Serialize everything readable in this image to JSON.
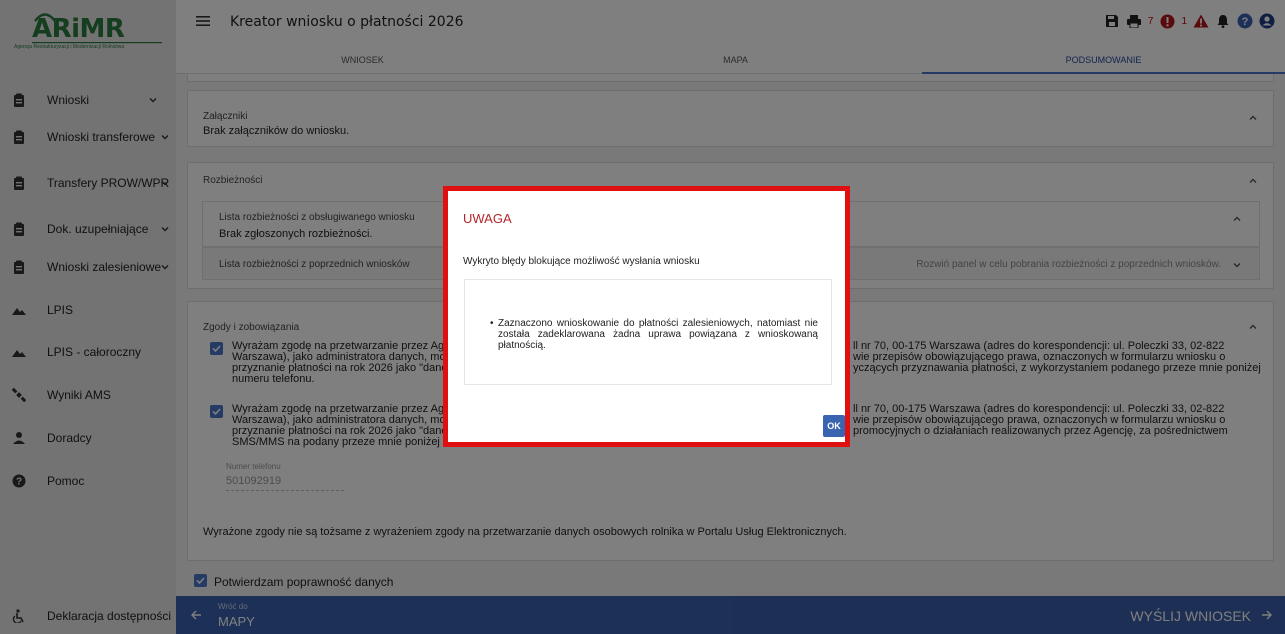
{
  "app": {
    "logo_text": "ARiMR",
    "logo_subtitle": "Agencja Restrukturyzacji i Modernizacji Rolnictwa",
    "title": "Kreator wniosku o płatności 2026"
  },
  "header_icons": {
    "error_count": "7",
    "warning_count": "1"
  },
  "tabs": [
    {
      "label": "WNIOSEK"
    },
    {
      "label": "MAPA"
    },
    {
      "label": "PODSUMOWANIE"
    }
  ],
  "sidebar": {
    "items": [
      {
        "label": "Wnioski",
        "icon": "clipboard-icon"
      },
      {
        "label": "Wnioski transferowe",
        "icon": "clipboard-icon"
      },
      {
        "label": "Transfery PROW/WPR",
        "icon": "clipboard-icon"
      },
      {
        "label": "Dok. uzupełniające",
        "icon": "clipboard-icon"
      },
      {
        "label": "Wnioski zalesieniowe",
        "icon": "clipboard-icon"
      },
      {
        "label": "LPIS",
        "icon": "map-terrain-icon"
      },
      {
        "label": "LPIS - całoroczny",
        "icon": "map-terrain-icon"
      },
      {
        "label": "Wyniki AMS",
        "icon": "satellite-icon"
      },
      {
        "label": "Doradcy",
        "icon": "person-icon"
      },
      {
        "label": "Pomoc",
        "icon": "help-icon"
      }
    ],
    "accessibility": "Deklaracja dostępności"
  },
  "attachments": {
    "title": "Załączniki",
    "text": "Brak załączników do wniosku."
  },
  "discrepancies": {
    "title": "Rozbieżności",
    "current_title": "Lista rozbieżności z obsługiwanego wniosku",
    "current_text": "Brak zgłoszonych rozbieżności.",
    "previous_title": "Lista rozbieżności z poprzednich wniosków",
    "previous_hint": "Rozwiń panel w celu pobrania rozbieżności z poprzednich wniosków."
  },
  "consents": {
    "title": "Zgody i zobowiązania",
    "c1_left": "Wyrażam zgodę na przetwarzanie przez Age\nWarszawa), jako administratora danych, moi\nprzyznanie płatności na rok 2026 jako \"dane\nnumeru telefonu.",
    "c1_right": "ll nr 70, 00-175 Warszawa (adres do korespondencji: ul. Poleczki 33, 02-822\nwie przepisów obowiązującego prawa, oznaczonych w formularzu wniosku o\nyczących przyznawania płatności, z wykorzystaniem podanego przeze mnie poniżej",
    "c2_left": "Wyrażam zgodę na przetwarzanie przez Age\nWarszawa), jako administratora danych, moi\nprzyznanie płatności na rok 2026 jako \"dane\nSMS/MMS na podany przeze mnie poniżej numer telefonu.",
    "c2_right": "ll nr 70, 00-175 Warszawa (adres do korespondencji: ul. Poleczki 33, 02-822\nwie przepisów obowiązującego prawa, oznaczonych w formularzu wniosku o\npromocyjnych o działaniach realizowanych przez Agencję, za pośrednictwem",
    "phone_label": "Numer telefonu",
    "phone_value": "501092919",
    "note": "Wyrażone zgody nie są tożsame z wyrażeniem zgody na przetwarzanie danych osobowych rolnika w Portalu Usług Elektronicznych."
  },
  "confirm": "Potwierdzam poprawność danych",
  "footer": {
    "back_small": "Wróć do",
    "back_big": "MAPY",
    "send": "WYŚLIJ WNIOSEK"
  },
  "modal": {
    "title": "UWAGA",
    "message": "Wykryto błędy blokujące możliwość wysłania wniosku",
    "bullet": "Zaznaczono wnioskowanie do płatności zalesieniowych, natomiast nie została zadeklarowana żadna uprawa powiązana z wnioskowaną płatnością.",
    "ok": "OK"
  },
  "colors": {
    "accent": "#3a63b0",
    "alert_red": "#e01010",
    "title_red": "#b4262b"
  }
}
